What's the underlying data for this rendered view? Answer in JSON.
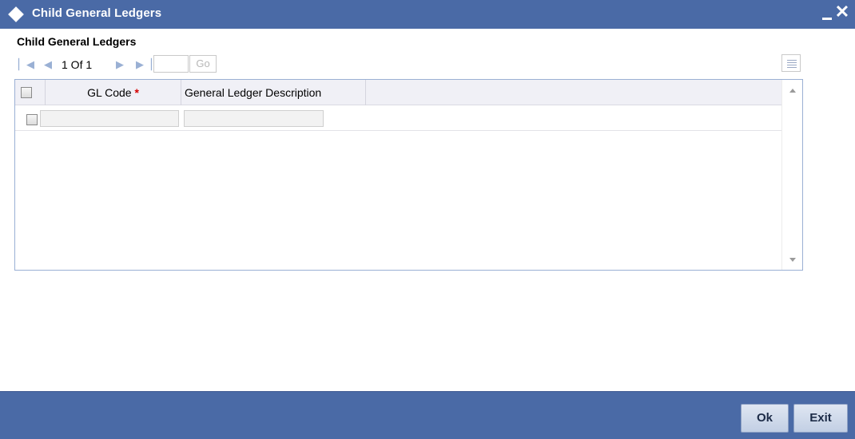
{
  "window": {
    "title": "Child General Ledgers",
    "minimize_label": "_",
    "close_label": "✕"
  },
  "section": {
    "title": "Child General Ledgers"
  },
  "pager": {
    "first_icon": "first-page-icon",
    "prev_icon": "prev-page-icon",
    "next_icon": "next-page-icon",
    "last_icon": "last-page-icon",
    "page_info": "1 Of 1",
    "page_input_value": "",
    "go_label": "Go"
  },
  "table": {
    "columns": [
      {
        "label": "GL Code",
        "required_mark": "*"
      },
      {
        "label": "General Ledger Description"
      }
    ],
    "rows": [
      {
        "gl_code": "",
        "description": ""
      }
    ]
  },
  "footer": {
    "ok_label": "Ok",
    "exit_label": "Exit"
  },
  "colors": {
    "titlebar": "#4a6aa6",
    "footer": "#4a6aa6",
    "required": "#d40000"
  }
}
